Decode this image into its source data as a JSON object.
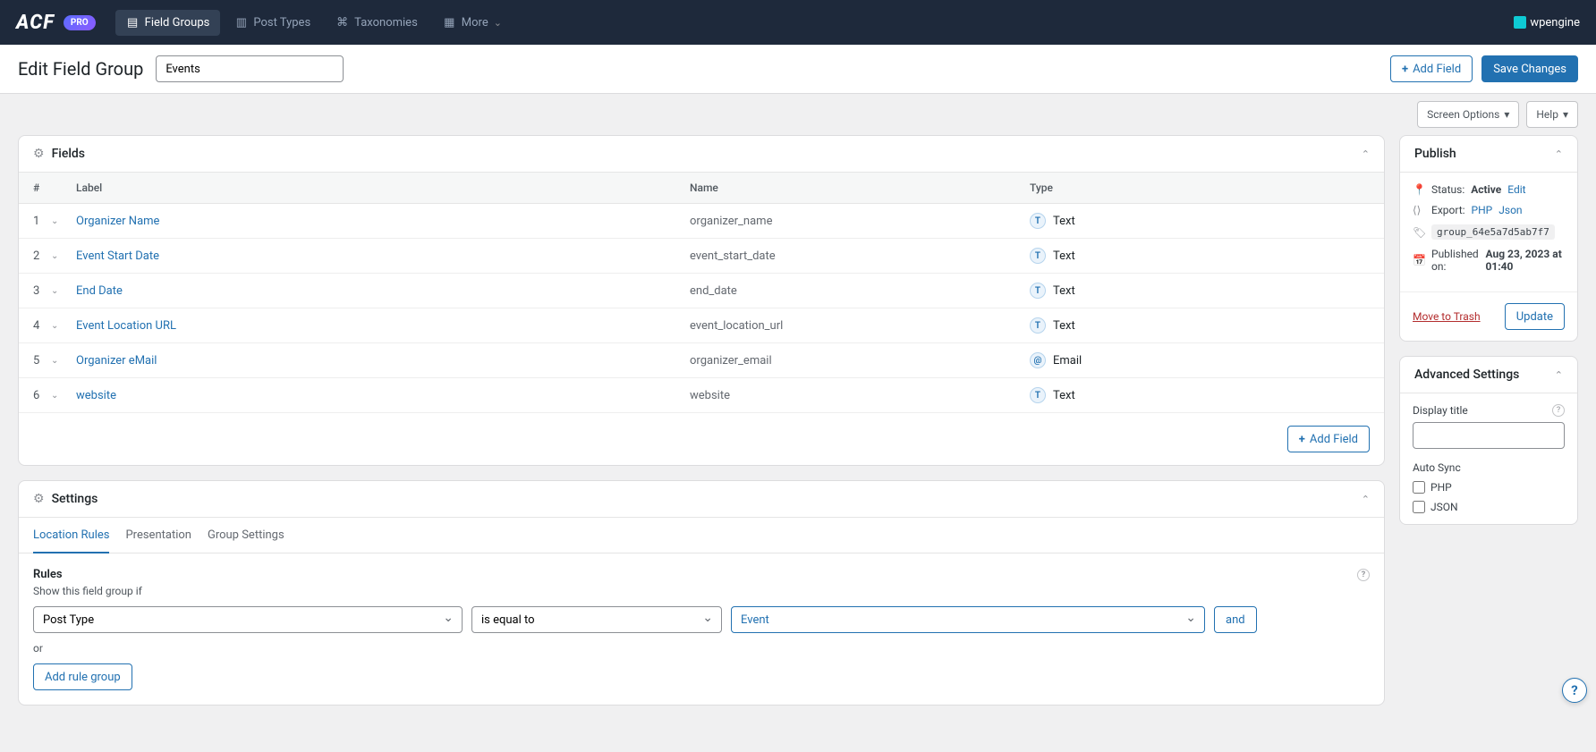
{
  "topnav": {
    "logo": "ACF",
    "pro": "PRO",
    "items": [
      {
        "label": "Field Groups"
      },
      {
        "label": "Post Types"
      },
      {
        "label": "Taxonomies"
      },
      {
        "label": "More"
      }
    ],
    "wpengine": "wpengine"
  },
  "header": {
    "title": "Edit Field Group",
    "group_name": "Events",
    "add_field": "Add Field",
    "save": "Save Changes",
    "screen_options": "Screen Options",
    "help": "Help"
  },
  "fields_panel": {
    "title": "Fields",
    "cols": {
      "num": "#",
      "label": "Label",
      "name": "Name",
      "type": "Type"
    },
    "rows": [
      {
        "num": "1",
        "label": "Organizer Name",
        "name": "organizer_name",
        "type": "Text",
        "icon": "T"
      },
      {
        "num": "2",
        "label": "Event Start Date",
        "name": "event_start_date",
        "type": "Text",
        "icon": "T"
      },
      {
        "num": "3",
        "label": "End Date",
        "name": "end_date",
        "type": "Text",
        "icon": "T"
      },
      {
        "num": "4",
        "label": "Event Location URL",
        "name": "event_location_url",
        "type": "Text",
        "icon": "T"
      },
      {
        "num": "5",
        "label": "Organizer eMail",
        "name": "organizer_email",
        "type": "Email",
        "icon": "@"
      },
      {
        "num": "6",
        "label": "website",
        "name": "website",
        "type": "Text",
        "icon": "T"
      }
    ],
    "add_field": "Add Field"
  },
  "settings_panel": {
    "title": "Settings",
    "tabs": [
      {
        "label": "Location Rules",
        "active": true
      },
      {
        "label": "Presentation"
      },
      {
        "label": "Group Settings"
      }
    ],
    "rules_label": "Rules",
    "rules_desc": "Show this field group if",
    "rule": {
      "param": "Post Type",
      "operator": "is equal to",
      "value": "Event",
      "and": "and"
    },
    "or": "or",
    "add_group": "Add rule group"
  },
  "publish": {
    "title": "Publish",
    "status_label": "Status:",
    "status": "Active",
    "edit": "Edit",
    "export_label": "Export:",
    "php": "PHP",
    "json": "Json",
    "key": "group_64e5a7d5ab7f7",
    "published_label": "Published on:",
    "published": "Aug 23, 2023 at 01:40",
    "trash": "Move to Trash",
    "update": "Update"
  },
  "advanced": {
    "title": "Advanced Settings",
    "display_title": "Display title",
    "auto_sync": "Auto Sync",
    "php": "PHP",
    "json": "JSON"
  }
}
